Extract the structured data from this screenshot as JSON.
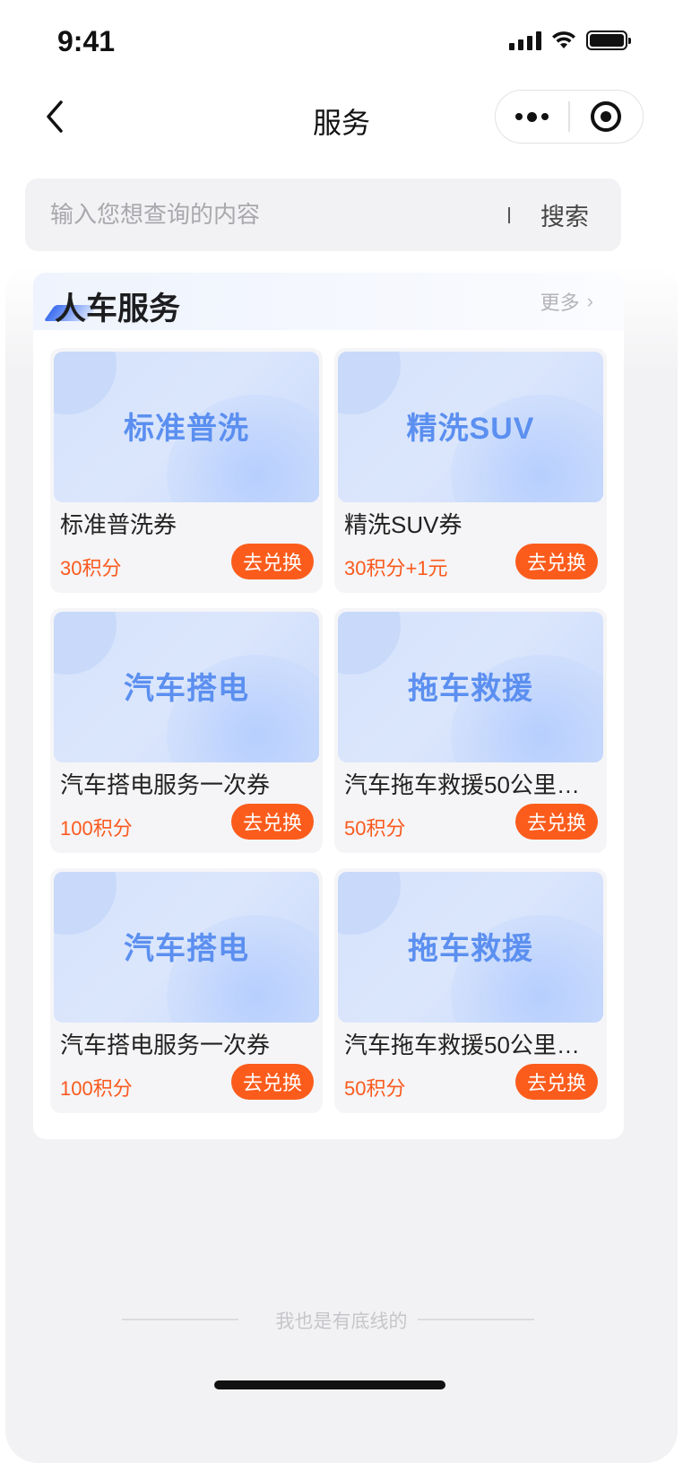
{
  "status_bar": {
    "time": "9:41"
  },
  "nav": {
    "title": "服务"
  },
  "search": {
    "placeholder": "输入您想查询的内容",
    "button_label": "搜索"
  },
  "section": {
    "title": "人车服务",
    "more_label": "更多",
    "items": [
      {
        "banner": "标准普洗",
        "name": "标准普洗券",
        "price": "30积分",
        "button": "去兑换"
      },
      {
        "banner": "精洗SUV",
        "name": "精洗SUV券",
        "price": "30积分+1元",
        "button": "去兑换"
      },
      {
        "banner": "汽车搭电",
        "name": "汽车搭电服务一次券",
        "price": "100积分",
        "button": "去兑换"
      },
      {
        "banner": "拖车救援",
        "name": "汽车拖车救援50公里…",
        "price": "50积分",
        "button": "去兑换"
      },
      {
        "banner": "汽车搭电",
        "name": "汽车搭电服务一次券",
        "price": "100积分",
        "button": "去兑换"
      },
      {
        "banner": "拖车救援",
        "name": "汽车拖车救援50公里…",
        "price": "50积分",
        "button": "去兑换"
      }
    ]
  },
  "footer": {
    "text": "我也是有底线的"
  },
  "colors": {
    "accent_orange": "#fb5c1c",
    "banner_text_blue": "#5b8ff0",
    "title_accent_blue": "#3d6ef0"
  },
  "icons": [
    "back-chevron-icon",
    "more-dots-icon",
    "target-icon",
    "signal-icon",
    "wifi-icon",
    "battery-icon",
    "chevron-right-icon"
  ]
}
